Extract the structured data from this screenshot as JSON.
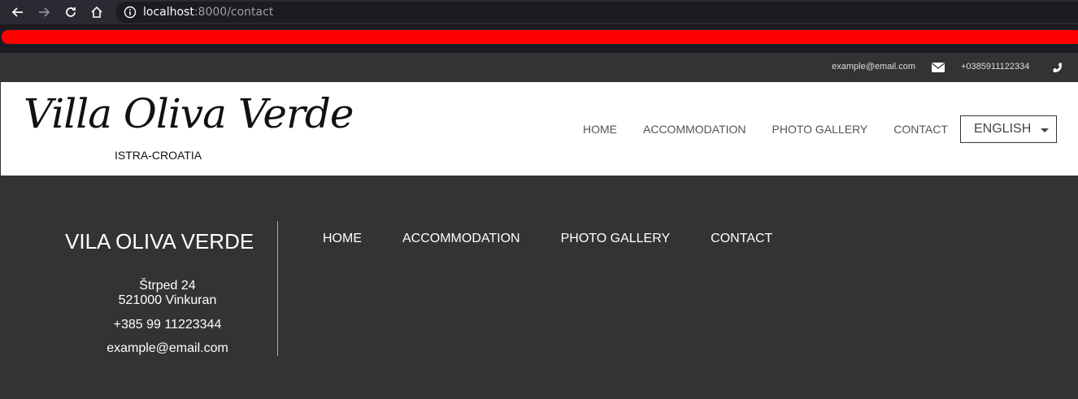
{
  "browser": {
    "url_host": "localhost",
    "url_path": ":8000/contact"
  },
  "topbar": {
    "email": "example@email.com",
    "phone": "+0385911122334"
  },
  "header": {
    "logo": "Villa Oliva Verde",
    "tagline": "ISTRA-CROATIA",
    "nav": [
      "HOME",
      "ACCOMMODATION",
      "PHOTO GALLERY",
      "CONTACT"
    ],
    "language": "ENGLISH"
  },
  "footer": {
    "brand": "VILA OLIVA VERDE",
    "street": "Štrped 24",
    "city": "521000 Vinkuran",
    "phone": "+385 99 11223344",
    "email": "example@email.com",
    "nav": [
      "HOME",
      "ACCOMMODATION",
      "PHOTO GALLERY",
      "CONTACT"
    ]
  },
  "colors": {
    "accent_bar": "#ff0000",
    "dark_bg": "#333333"
  }
}
